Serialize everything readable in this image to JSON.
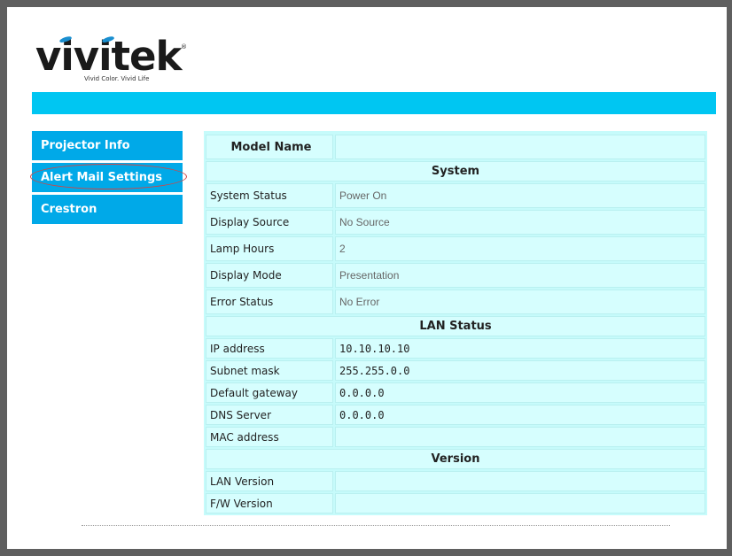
{
  "brand": {
    "logo_text": "vivitek",
    "registered": "®",
    "tagline": "Vivid Color. Vivid Life"
  },
  "colors": {
    "header_bar": "#00c6f2",
    "nav_bg": "#00a9e8",
    "table_bg": "#c6fbfb",
    "highlight": "#d04545"
  },
  "nav": {
    "items": [
      {
        "label": "Projector Info"
      },
      {
        "label": "Alert Mail Settings"
      },
      {
        "label": "Crestron"
      }
    ]
  },
  "info": {
    "model_name_label": "Model Name",
    "model_name_value": "",
    "system_header": "System",
    "system": [
      {
        "key": "System Status",
        "value": "Power On"
      },
      {
        "key": "Display Source",
        "value": "No Source"
      },
      {
        "key": "Lamp Hours",
        "value": "2"
      },
      {
        "key": "Display Mode",
        "value": "Presentation"
      },
      {
        "key": "Error Status",
        "value": "No Error"
      }
    ],
    "lan_header": "LAN Status",
    "lan": [
      {
        "key": "IP address",
        "value": "10.10.10.10"
      },
      {
        "key": "Subnet mask",
        "value": "255.255.0.0"
      },
      {
        "key": "Default gateway",
        "value": "0.0.0.0"
      },
      {
        "key": "DNS Server",
        "value": "0.0.0.0"
      },
      {
        "key": "MAC address",
        "value": ""
      }
    ],
    "version_header": "Version",
    "version": [
      {
        "key": "LAN Version",
        "value": ""
      },
      {
        "key": "F/W Version",
        "value": ""
      }
    ]
  }
}
